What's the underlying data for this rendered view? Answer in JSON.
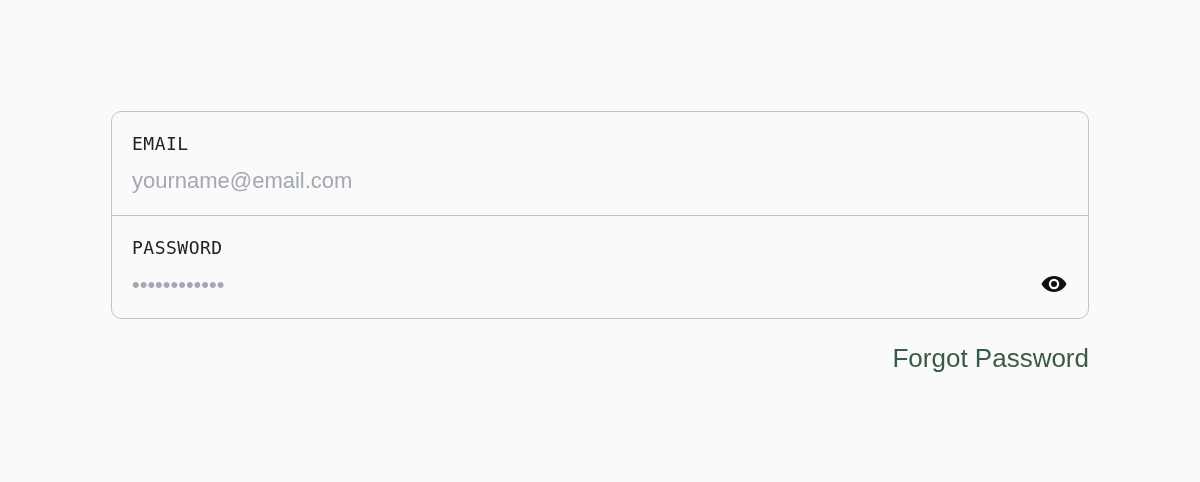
{
  "form": {
    "fields": [
      {
        "kind": "email",
        "label": "EMAIL",
        "placeholder": "yourname@email.com"
      },
      {
        "kind": "password",
        "label": "PASSWORD",
        "placeholder": "••••••••••••"
      }
    ]
  },
  "forgot_link": "Forgot Password"
}
